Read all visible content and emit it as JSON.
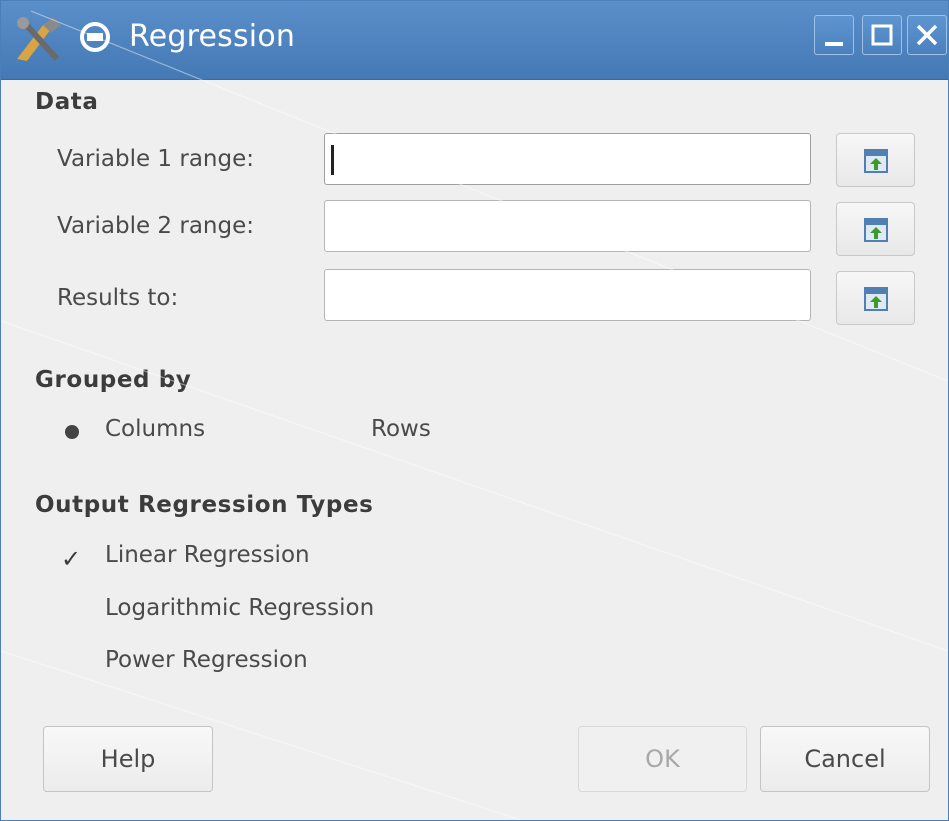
{
  "window": {
    "title": "Regression",
    "app_icon": "tools-icon",
    "menu_icon": "window-menu-icon",
    "controls": [
      "minimize-icon",
      "maximize-icon",
      "close-icon"
    ]
  },
  "data_section": {
    "title": "Data",
    "rows": [
      {
        "label": "Variable 1 range:",
        "value": ""
      },
      {
        "label": "Variable 2 range:",
        "value": ""
      },
      {
        "label": "Results to:",
        "value": ""
      }
    ],
    "picker_icon": "select-range-icon"
  },
  "grouped_by": {
    "title": "Grouped by",
    "options": [
      "Columns",
      "Rows"
    ],
    "selected": "Columns"
  },
  "output_types": {
    "title": "Output Regression Types",
    "options": [
      {
        "label": "Linear Regression",
        "checked": true
      },
      {
        "label": "Logarithmic Regression",
        "checked": false
      },
      {
        "label": "Power Regression",
        "checked": false
      }
    ]
  },
  "buttons": {
    "help": "Help",
    "ok": "OK",
    "cancel": "Cancel"
  },
  "colors": {
    "titlebar": "#4a80bd",
    "background": "#efefef"
  }
}
